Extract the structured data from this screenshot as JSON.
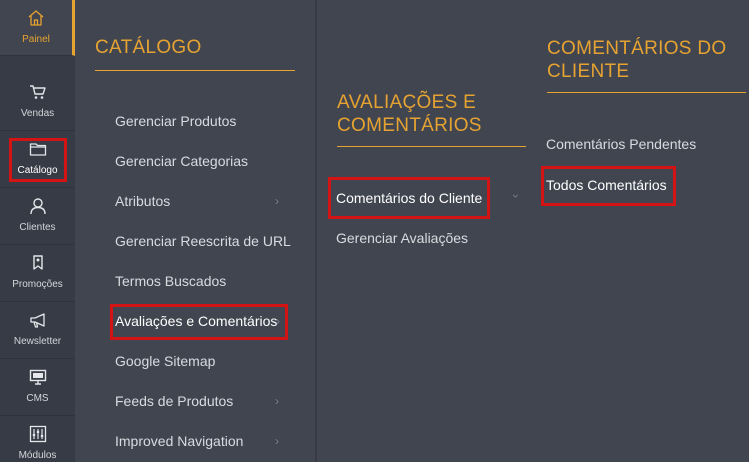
{
  "rail": {
    "items": [
      {
        "label": "Painel",
        "icon": "home-icon"
      },
      {
        "label": "Vendas",
        "icon": "cart-icon"
      },
      {
        "label": "Catálogo",
        "icon": "folder-icon"
      },
      {
        "label": "Clientes",
        "icon": "user-icon"
      },
      {
        "label": "Promoções",
        "icon": "tag-icon"
      },
      {
        "label": "Newsletter",
        "icon": "megaphone-icon"
      },
      {
        "label": "CMS",
        "icon": "monitor-icon"
      },
      {
        "label": "Módulos",
        "icon": "sliders-icon"
      }
    ]
  },
  "catalog_panel": {
    "title": "CATÁLOGO",
    "items": [
      "Gerenciar Produtos",
      "Gerenciar Categorias",
      "Atributos",
      "Gerenciar Reescrita de URL",
      "Termos Buscados",
      "Avaliações e Comentários",
      "Google Sitemap",
      "Feeds de Produtos",
      "Improved Navigation"
    ]
  },
  "reviews_panel": {
    "title_line1": "AVALIAÇÕES E",
    "title_line2": "COMENTÁRIOS",
    "items": [
      "Comentários do Cliente",
      "Gerenciar Avaliações"
    ]
  },
  "customer_reviews_panel": {
    "title_line1": "COMENTÁRIOS DO",
    "title_line2": "CLIENTE",
    "items": [
      "Comentários Pendentes",
      "Todos Comentários"
    ]
  },
  "colors": {
    "accent": "#e6a331",
    "highlight": "#d41414",
    "rail_bg": "#373b45",
    "panel_bg": "#414550"
  }
}
